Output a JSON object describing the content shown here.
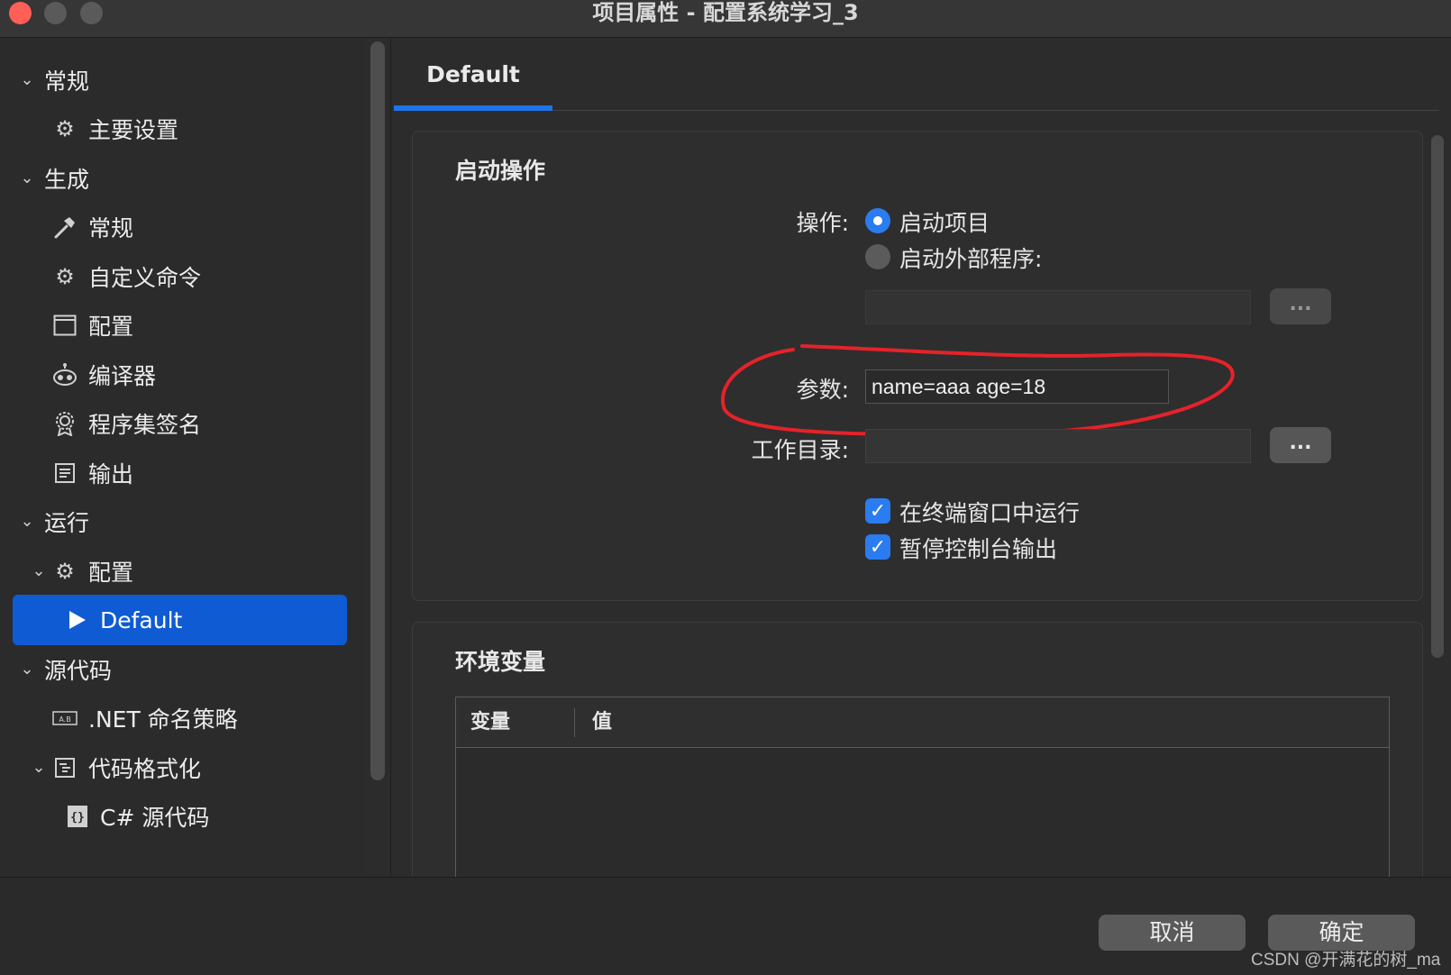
{
  "window": {
    "title": "项目属性 - 配置系统学习_3"
  },
  "sidebar": {
    "items": [
      {
        "label": "常规",
        "icon": "chevron-down-icon",
        "level": 0
      },
      {
        "label": "主要设置",
        "icon": "gear-icon",
        "level": 1
      },
      {
        "label": "生成",
        "icon": "chevron-down-icon",
        "level": 0
      },
      {
        "label": "常规",
        "icon": "hammer-icon",
        "level": 1
      },
      {
        "label": "自定义命令",
        "icon": "gear-icon",
        "level": 1
      },
      {
        "label": "配置",
        "icon": "window-icon",
        "level": 1
      },
      {
        "label": "编译器",
        "icon": "robot-icon",
        "level": 1
      },
      {
        "label": "程序集签名",
        "icon": "badge-icon",
        "level": 1
      },
      {
        "label": "输出",
        "icon": "document-icon",
        "level": 1
      },
      {
        "label": "运行",
        "icon": "chevron-down-icon",
        "level": 0
      },
      {
        "label": "配置",
        "icon": "gear-icon",
        "level": 1
      },
      {
        "label": "Default",
        "icon": "play-icon",
        "level": 2,
        "selected": true
      },
      {
        "label": "源代码",
        "icon": "chevron-down-icon",
        "level": 0
      },
      {
        "label": ".NET 命名策略",
        "icon": "name-icon",
        "level": 1
      },
      {
        "label": "代码格式化",
        "icon": "format-icon",
        "level": 1
      },
      {
        "label": "C# 源代码",
        "icon": "braces-icon",
        "level": 2
      }
    ]
  },
  "tabs": {
    "active": "Default"
  },
  "start_action": {
    "title": "启动操作",
    "action_label": "操作:",
    "option_project": "启动项目",
    "option_external": "启动外部程序:",
    "external_path": "",
    "browse_label": "...",
    "args_label": "参数:",
    "args_value": "name=aaa age=18",
    "workdir_label": "工作目录:",
    "workdir_value": "",
    "run_in_terminal": "在终端窗口中运行",
    "pause_console": "暂停控制台输出"
  },
  "env": {
    "title": "环境变量",
    "col_var": "变量",
    "col_value": "值"
  },
  "footer": {
    "cancel": "取消",
    "ok": "确定",
    "watermark": "CSDN @开满花的树_ma"
  },
  "colors": {
    "accent": "#1f73e8",
    "selected": "#0f5bd4",
    "annotation": "#e5222a"
  }
}
